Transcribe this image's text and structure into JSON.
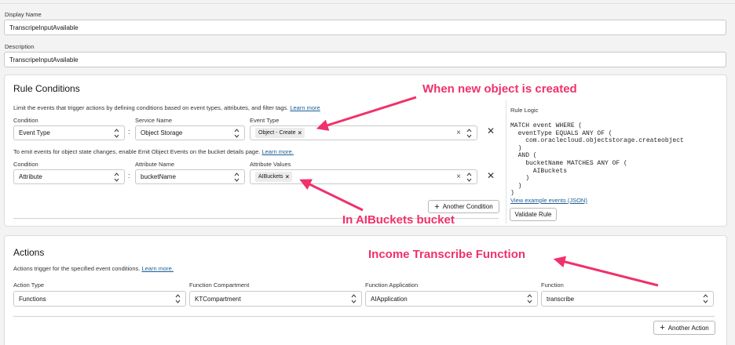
{
  "form": {
    "display_name_label": "Display Name",
    "display_name_value": "TranscripeInputAvailable",
    "description_label": "Description",
    "description_value": "TranscripeInputAvailable"
  },
  "rule_conditions": {
    "title": "Rule Conditions",
    "hint": "Limit the events that trigger actions by defining conditions based on event types, attributes, and filter tags.",
    "hint_link": "Learn more",
    "row1": {
      "condition_label": "Condition",
      "condition_value": "Event Type",
      "service_label": "Service Name",
      "service_value": "Object Storage",
      "event_type_label": "Event Type",
      "event_type_chip": "Object - Create"
    },
    "emit_hint": "To emit events for object state changes, enable Emit Object Events on the bucket details page.",
    "emit_link": "Learn more.",
    "row2": {
      "condition_label": "Condition",
      "condition_value": "Attribute",
      "attr_name_label": "Attribute Name",
      "attr_name_value": "bucketName",
      "attr_values_label": "Attribute Values",
      "attr_values_chip": "AIBuckets"
    },
    "another_condition": "Another Condition",
    "rule_logic_label": "Rule Logic",
    "rule_logic_code": "MATCH event WHERE (\n  eventType EQUALS ANY OF (\n    com.oraclecloud.objectstorage.createobject\n  )\n  AND (\n    bucketName MATCHES ANY OF (\n      AIBuckets\n    )\n  )\n)",
    "view_example": "View example events (JSON)",
    "validate_rule": "Validate Rule"
  },
  "actions": {
    "title": "Actions",
    "hint": "Actions trigger for the specified event conditions.",
    "hint_link": "Learn more.",
    "action_type_label": "Action Type",
    "action_type_value": "Functions",
    "compartment_label": "Function Compartment",
    "compartment_value": "KTCompartment",
    "application_label": "Function Application",
    "application_value": "AIApplication",
    "function_label": "Function",
    "function_value": "transcribe",
    "another_action": "Another Action"
  },
  "annotations": {
    "a1": "When new object is created",
    "a2": "In AIBuckets bucket",
    "a3": "Income Transcribe Function",
    "color": "#f0316b"
  }
}
